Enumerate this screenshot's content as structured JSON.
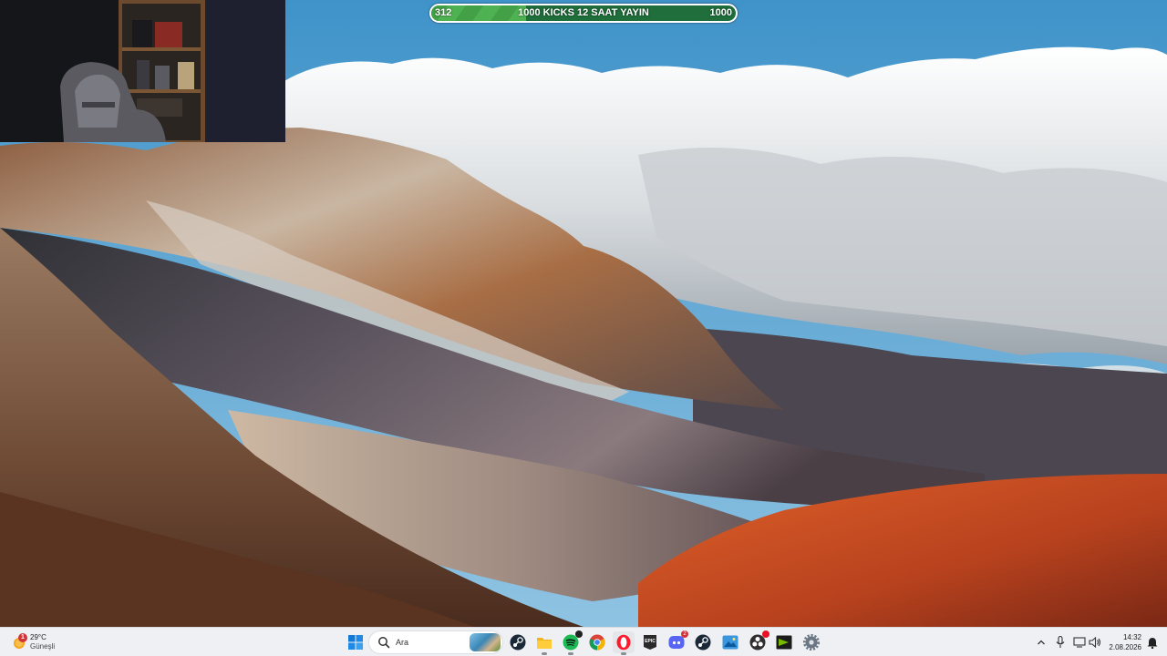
{
  "goal_bar": {
    "current": "312",
    "title": "1000 KICKS 12 SAAT YAYIN",
    "target": "1000",
    "progress_fraction": 0.312
  },
  "taskbar": {
    "weather": {
      "temperature": "29°C",
      "condition": "Güneşli",
      "badge": "1",
      "icon": "sun-icon"
    },
    "start_icon": "windows-start-icon",
    "search": {
      "placeholder": "Ara",
      "icon": "search-icon"
    },
    "pinned_apps": [
      {
        "name": "steam",
        "icon": "steam-icon"
      },
      {
        "name": "file-explorer",
        "icon": "folder-icon",
        "active": true
      },
      {
        "name": "spotify",
        "icon": "spotify-icon",
        "active": true
      },
      {
        "name": "chrome",
        "icon": "chrome-icon"
      },
      {
        "name": "opera",
        "icon": "opera-icon",
        "active": true
      },
      {
        "name": "epic-games",
        "icon": "epic-games-icon"
      },
      {
        "name": "discord",
        "icon": "discord-icon",
        "badge": "2"
      },
      {
        "name": "steam-2",
        "icon": "steam-icon"
      },
      {
        "name": "photos",
        "icon": "photos-icon"
      },
      {
        "name": "obs",
        "icon": "obs-icon"
      },
      {
        "name": "nvidia",
        "icon": "nvidia-icon"
      },
      {
        "name": "settings",
        "icon": "gear-icon"
      }
    ],
    "tray": {
      "chevron": "chevron-up-icon",
      "mic": "microphone-icon",
      "network": "network-icon",
      "volume": "volume-icon",
      "time": "14:32",
      "date": "2.08.2026",
      "notifications": "notification-icon"
    }
  },
  "colors": {
    "goal_fill": "#43a047",
    "goal_bg": "#1f6e3b",
    "taskbar_bg": "#eef0f3",
    "badge_red": "#d13438"
  }
}
